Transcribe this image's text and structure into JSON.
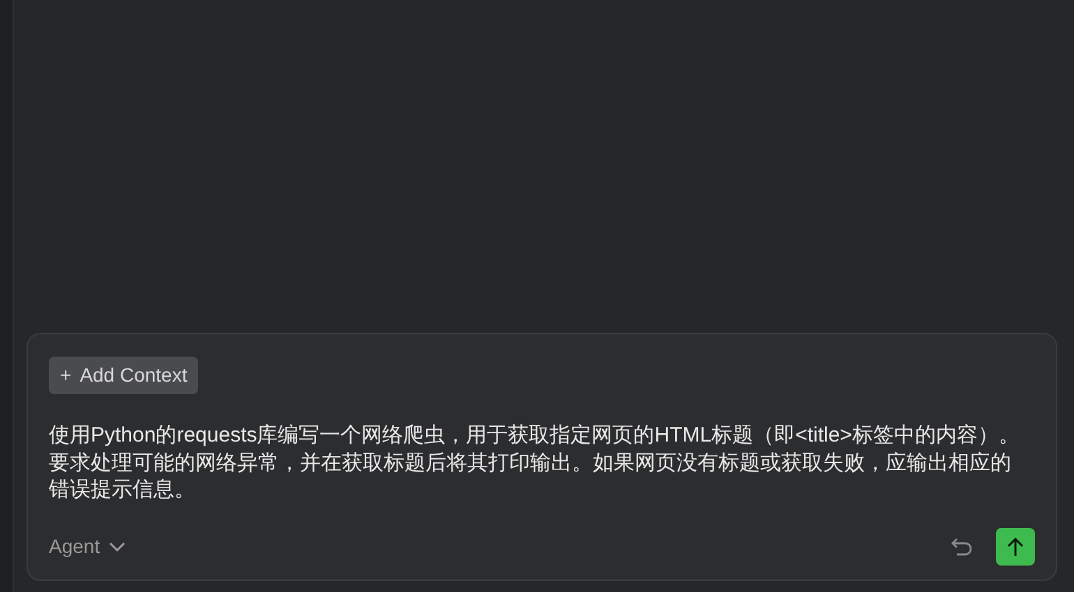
{
  "composer": {
    "add_context": {
      "icon": "+",
      "label": "Add Context"
    },
    "prompt": "使用Python的requests库编写一个网络爬虫，用于获取指定网页的HTML标题（即<title>标签中的内容）。要求处理可能的网络异常，并在获取标题后将其打印输出。如果网页没有标题或获取失败，应输出相应的错误提示信息。",
    "mode": "Agent"
  }
}
